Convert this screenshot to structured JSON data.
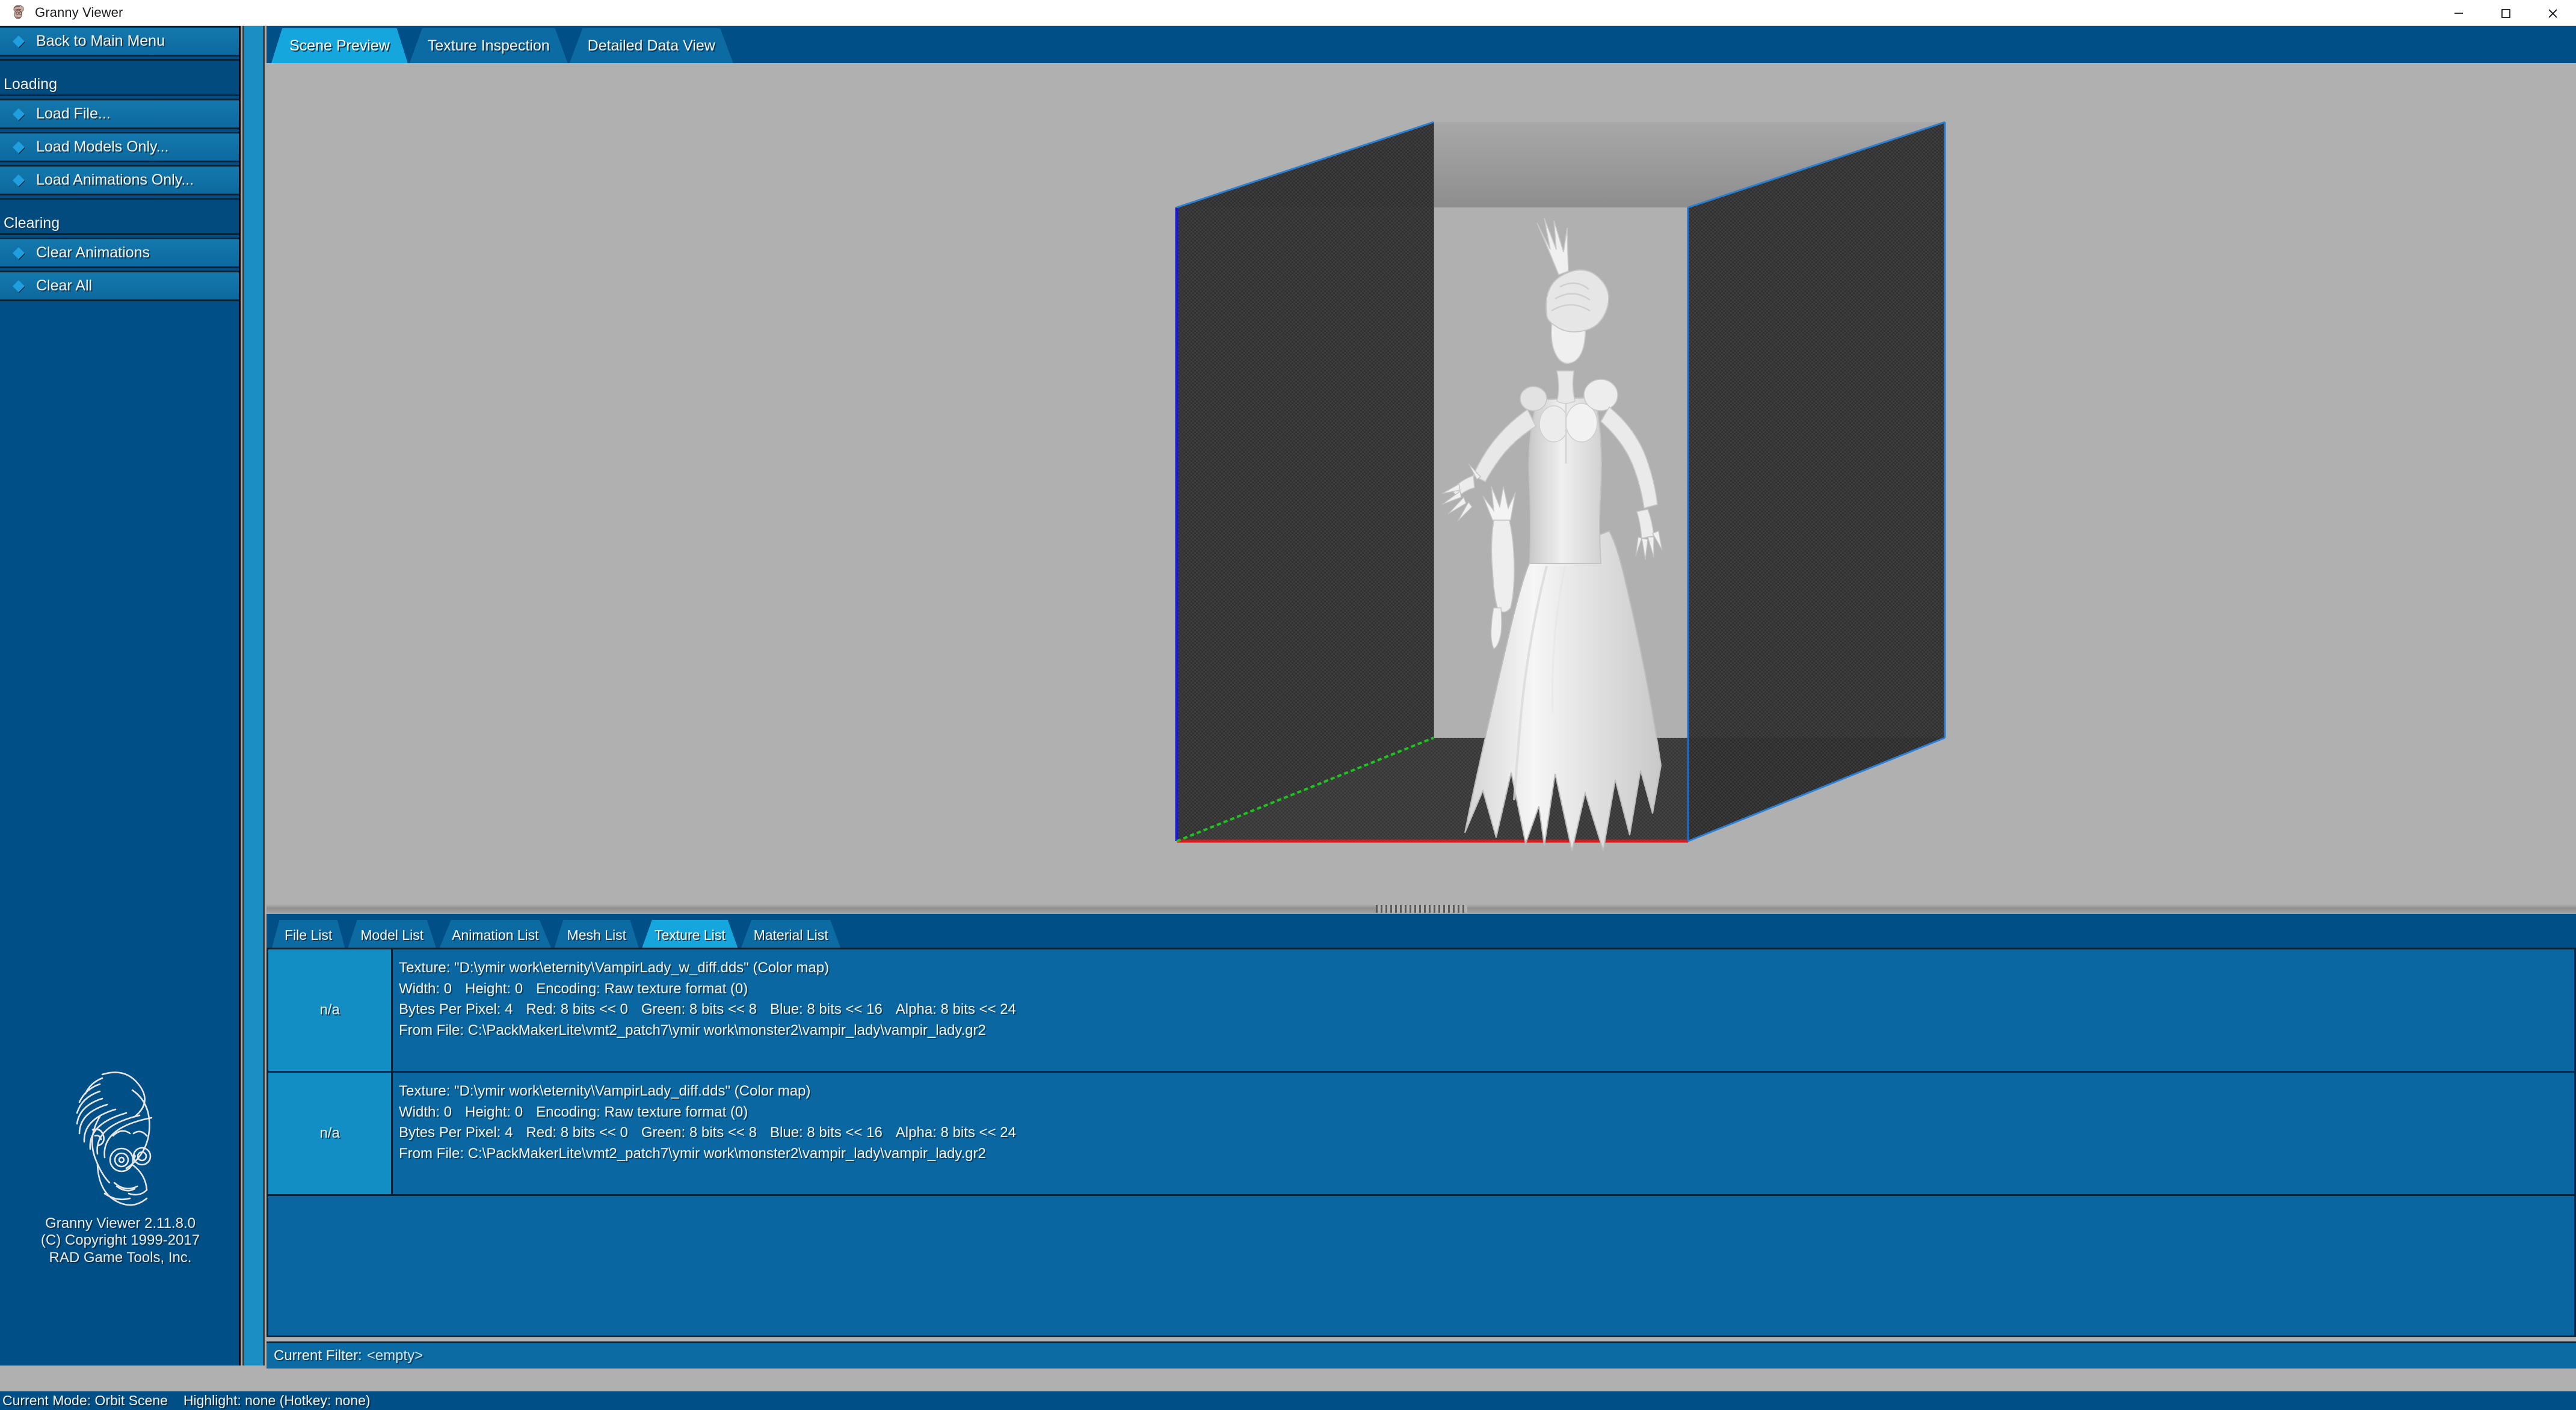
{
  "window": {
    "title": "Granny Viewer",
    "icon": "granny-app-icon",
    "controls": [
      {
        "name": "minimize",
        "glyph": "minimize-icon"
      },
      {
        "name": "maximize",
        "glyph": "maximize-icon"
      },
      {
        "name": "close",
        "glyph": "close-icon"
      }
    ]
  },
  "sidebar": {
    "back_button": {
      "label": "Back to Main Menu",
      "icon": "diamond-bullet-icon"
    },
    "groups": [
      {
        "header": "Loading",
        "items": [
          {
            "label": "Load File...",
            "icon": "diamond-bullet-icon"
          },
          {
            "label": "Load Models Only...",
            "icon": "diamond-bullet-icon"
          },
          {
            "label": "Load Animations Only...",
            "icon": "diamond-bullet-icon"
          }
        ]
      },
      {
        "header": "Clearing",
        "items": [
          {
            "label": "Clear Animations",
            "icon": "diamond-bullet-icon"
          },
          {
            "label": "Clear All",
            "icon": "diamond-bullet-icon"
          }
        ]
      }
    ],
    "logo": {
      "icon": "granny-face-logo",
      "line1": "Granny Viewer 2.11.8.0",
      "line2": "(C) Copyright 1999-2017",
      "line3": "RAD Game Tools, Inc."
    }
  },
  "top_tabs": [
    {
      "label": "Scene Preview",
      "active": true
    },
    {
      "label": "Texture Inspection",
      "active": false
    },
    {
      "label": "Detailed Data View",
      "active": false
    }
  ],
  "bottom_tabs": [
    {
      "label": "File List",
      "active": false
    },
    {
      "label": "Model List",
      "active": false
    },
    {
      "label": "Animation List",
      "active": false
    },
    {
      "label": "Mesh List",
      "active": false
    },
    {
      "label": "Texture List",
      "active": true
    },
    {
      "label": "Material List",
      "active": false
    }
  ],
  "viewport": {
    "name": "scene-preview-3d-viewport",
    "background_color": "#b0b0b0",
    "box_top_color": "#9a9a9a",
    "box_wall_color": "#3b3b3b",
    "axis_x_color": "#d61d1d",
    "axis_y_color": "#1ec41e",
    "axis_z_color": "#1b1bd6",
    "model_color": "#e9e9e9",
    "model_description": "Vampire lady character model in white dress inside bounding box"
  },
  "texture_list": {
    "rows": [
      {
        "thumbnail_label": "n/a",
        "line1": "Texture: \"D:\\ymir work\\eternity\\VampirLady_w_diff.dds\" (Color map)",
        "line2_width_label": "Width: 0",
        "line2_height_label": "Height: 0",
        "line2_encoding_label": "Encoding: Raw texture format (0)",
        "line3_bpp": "Bytes Per Pixel: 4",
        "line3_red": "Red: 8 bits << 0",
        "line3_green": "Green: 8 bits << 8",
        "line3_blue": "Blue: 8 bits << 16",
        "line3_alpha": "Alpha: 8 bits << 24",
        "line4": "From File: C:\\PackMakerLite\\vmt2_patch7\\ymir work\\monster2\\vampir_lady\\vampir_lady.gr2"
      },
      {
        "thumbnail_label": "n/a",
        "line1": "Texture: \"D:\\ymir work\\eternity\\VampirLady_diff.dds\" (Color map)",
        "line2_width_label": "Width: 0",
        "line2_height_label": "Height: 0",
        "line2_encoding_label": "Encoding: Raw texture format (0)",
        "line3_bpp": "Bytes Per Pixel: 4",
        "line3_red": "Red: 8 bits << 0",
        "line3_green": "Green: 8 bits << 8",
        "line3_blue": "Blue: 8 bits << 16",
        "line3_alpha": "Alpha: 8 bits << 24",
        "line4": "From File: C:\\PackMakerLite\\vmt2_patch7\\ymir work\\monster2\\vampir_lady\\vampir_lady.gr2"
      }
    ]
  },
  "filter_bar": {
    "label": "Current Filter:",
    "value": "<empty>"
  },
  "status_bar": {
    "mode": "Current Mode: Orbit Scene",
    "highlight": "Highlight: none (Hotkey: none)"
  }
}
